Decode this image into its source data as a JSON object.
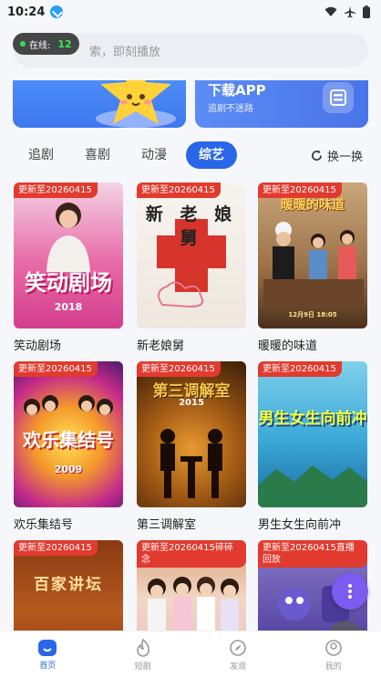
{
  "status": {
    "time": "10:24"
  },
  "search": {
    "placeholder": "输入片名搜索，即刻播放",
    "visible_text": "索，即刻播放"
  },
  "online": {
    "label": "在线:",
    "count": "12"
  },
  "banner_right": {
    "title": "下载APP",
    "subtitle": "追剧不迷路"
  },
  "tabs": [
    {
      "label": "追剧",
      "active": false
    },
    {
      "label": "喜剧",
      "active": false
    },
    {
      "label": "动漫",
      "active": false
    },
    {
      "label": "综艺",
      "active": true
    }
  ],
  "refresh_label": "换一换",
  "items": [
    {
      "badge": "更新至20260415",
      "name": "笑动剧场",
      "poster_text": "笑动剧场",
      "poster_sub": "2018"
    },
    {
      "badge": "更新至20260415",
      "name": "新老娘舅",
      "poster_text": "新 老 娘 舅"
    },
    {
      "badge": "更新至20260415",
      "name": "暖暖的味道",
      "poster_text": "暖暖的味道",
      "poster_sub": "12月9日 18:05"
    },
    {
      "badge": "更新至20260415",
      "name": "欢乐集结号",
      "poster_text": "欢乐集结号",
      "poster_sub": "2009"
    },
    {
      "badge": "更新至20260415",
      "name": "第三调解室",
      "poster_text": "第三调解室",
      "poster_sub": "2015"
    },
    {
      "badge": "更新至20260415",
      "name": "男生女生向前冲",
      "poster_text": "男生女生向前冲"
    },
    {
      "badge": "更新至20260415",
      "name": "",
      "poster_text": "百家讲坛"
    },
    {
      "badge": "更新至20260415碎碎念",
      "name": "",
      "poster_text": ""
    },
    {
      "badge": "更新至20260415直播回放",
      "name": "",
      "poster_text": ""
    }
  ],
  "nav": [
    {
      "label": "首页",
      "icon": "home-icon",
      "active": true
    },
    {
      "label": "短剧",
      "icon": "flame-icon",
      "active": false
    },
    {
      "label": "发现",
      "icon": "compass-icon",
      "active": false
    },
    {
      "label": "我的",
      "icon": "user-icon",
      "active": false
    }
  ],
  "colors": {
    "accent": "#2a66e8",
    "badge": "#e23a2e",
    "fab": "#7b5cf0"
  }
}
